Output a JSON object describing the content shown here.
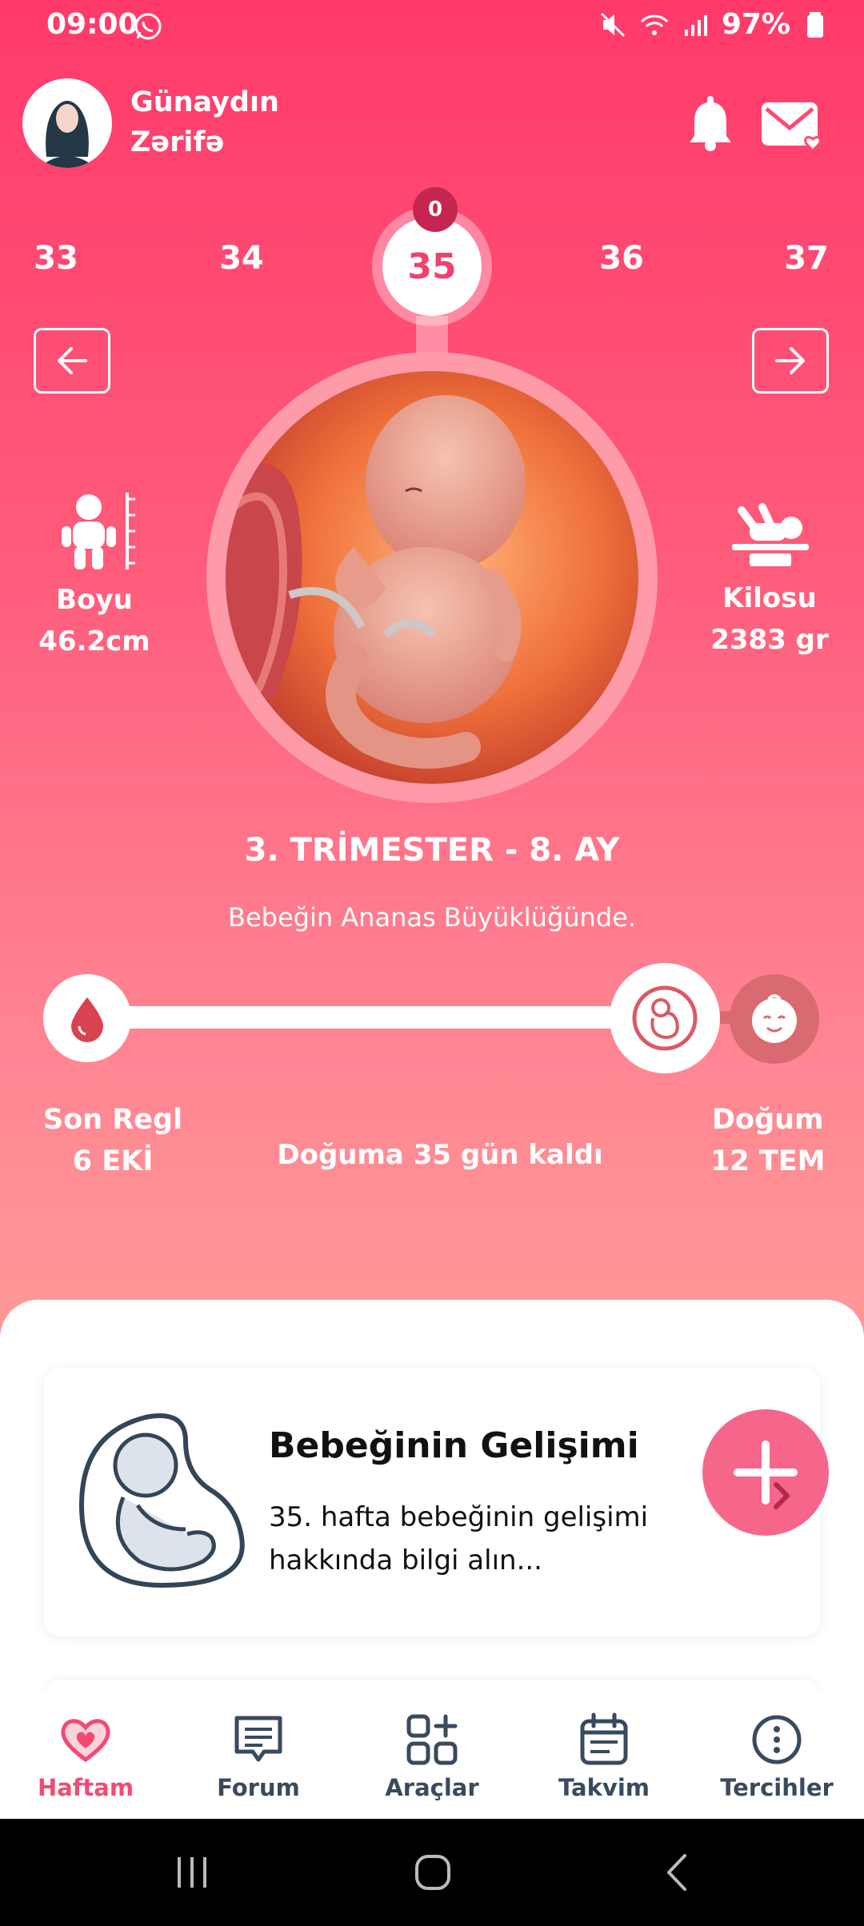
{
  "status_bar": {
    "time": "09:00",
    "battery": "97%"
  },
  "header": {
    "greeting": "Günaydın",
    "name": "Zərifə"
  },
  "weeks": {
    "prev2": "33",
    "prev1": "34",
    "current": "35",
    "next1": "36",
    "next2": "37",
    "badge": "0"
  },
  "baby": {
    "length_label": "Boyu",
    "length_value": "46.2cm",
    "weight_label": "Kilosu",
    "weight_value": "2383 gr",
    "trimester": "3. TRİMESTER - 8. AY",
    "size_text": "Bebeğin Ananas Büyüklüğünde."
  },
  "timeline": {
    "start_label": "Son Regl",
    "start_date": "6 EKİ",
    "end_label": "Doğum",
    "end_date": "12 TEM",
    "countdown": "Doğuma 35 gün kaldı"
  },
  "card": {
    "title": "Bebeğinin Gelişimi",
    "description": "35. hafta bebeğinin gelişimi hakkında bilgi alın..."
  },
  "nav": [
    {
      "label": "Haftam",
      "icon": "heart-icon",
      "active": true
    },
    {
      "label": "Forum",
      "icon": "chat-icon"
    },
    {
      "label": "Araçlar",
      "icon": "tools-grid-icon"
    },
    {
      "label": "Takvim",
      "icon": "calendar-icon"
    },
    {
      "label": "Tercihler",
      "icon": "more-icon"
    }
  ],
  "colors": {
    "primary": "#ff3a6a",
    "accent": "#f6668a",
    "nav_active": "#f24a73",
    "nav_inactive": "#394a5e"
  }
}
